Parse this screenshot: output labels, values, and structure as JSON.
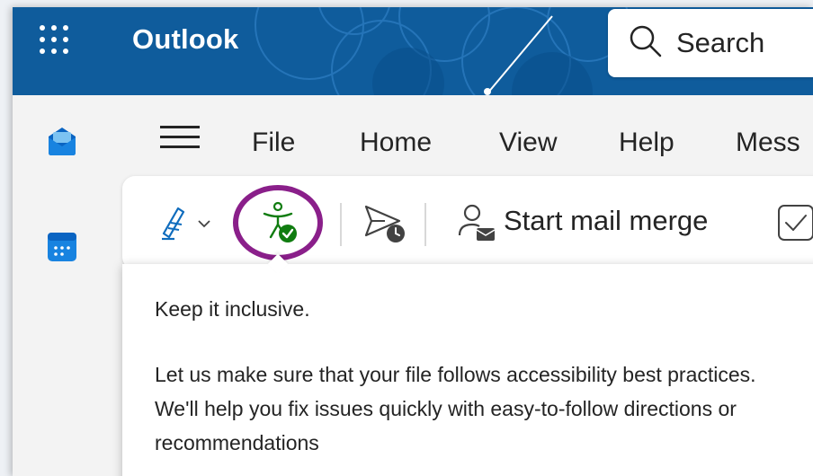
{
  "app": {
    "title": "Outlook",
    "brand_color": "#0f5c9c"
  },
  "search": {
    "label": "Search"
  },
  "menu": {
    "items": [
      "File",
      "Home",
      "View",
      "Help",
      "Mess"
    ]
  },
  "ribbon": {
    "mail_merge_label": "Start mail merge",
    "highlight_color": "#8a1f8a",
    "accessibility_icon_color": "#107c10"
  },
  "callout": {
    "heading": "Keep it inclusive.",
    "body": "Let us make sure that your file follows accessibility best practices. We'll help you fix issues quickly with easy-to-follow directions or recommendations"
  },
  "icons": {
    "app_launcher": "waffle-icon",
    "search": "search-icon",
    "mail": "mail-app-icon",
    "calendar": "calendar-app-icon",
    "signature": "signature-icon",
    "accessibility": "accessibility-checker-icon",
    "schedule_send": "schedule-send-icon",
    "mail_merge": "mail-merge-icon"
  }
}
